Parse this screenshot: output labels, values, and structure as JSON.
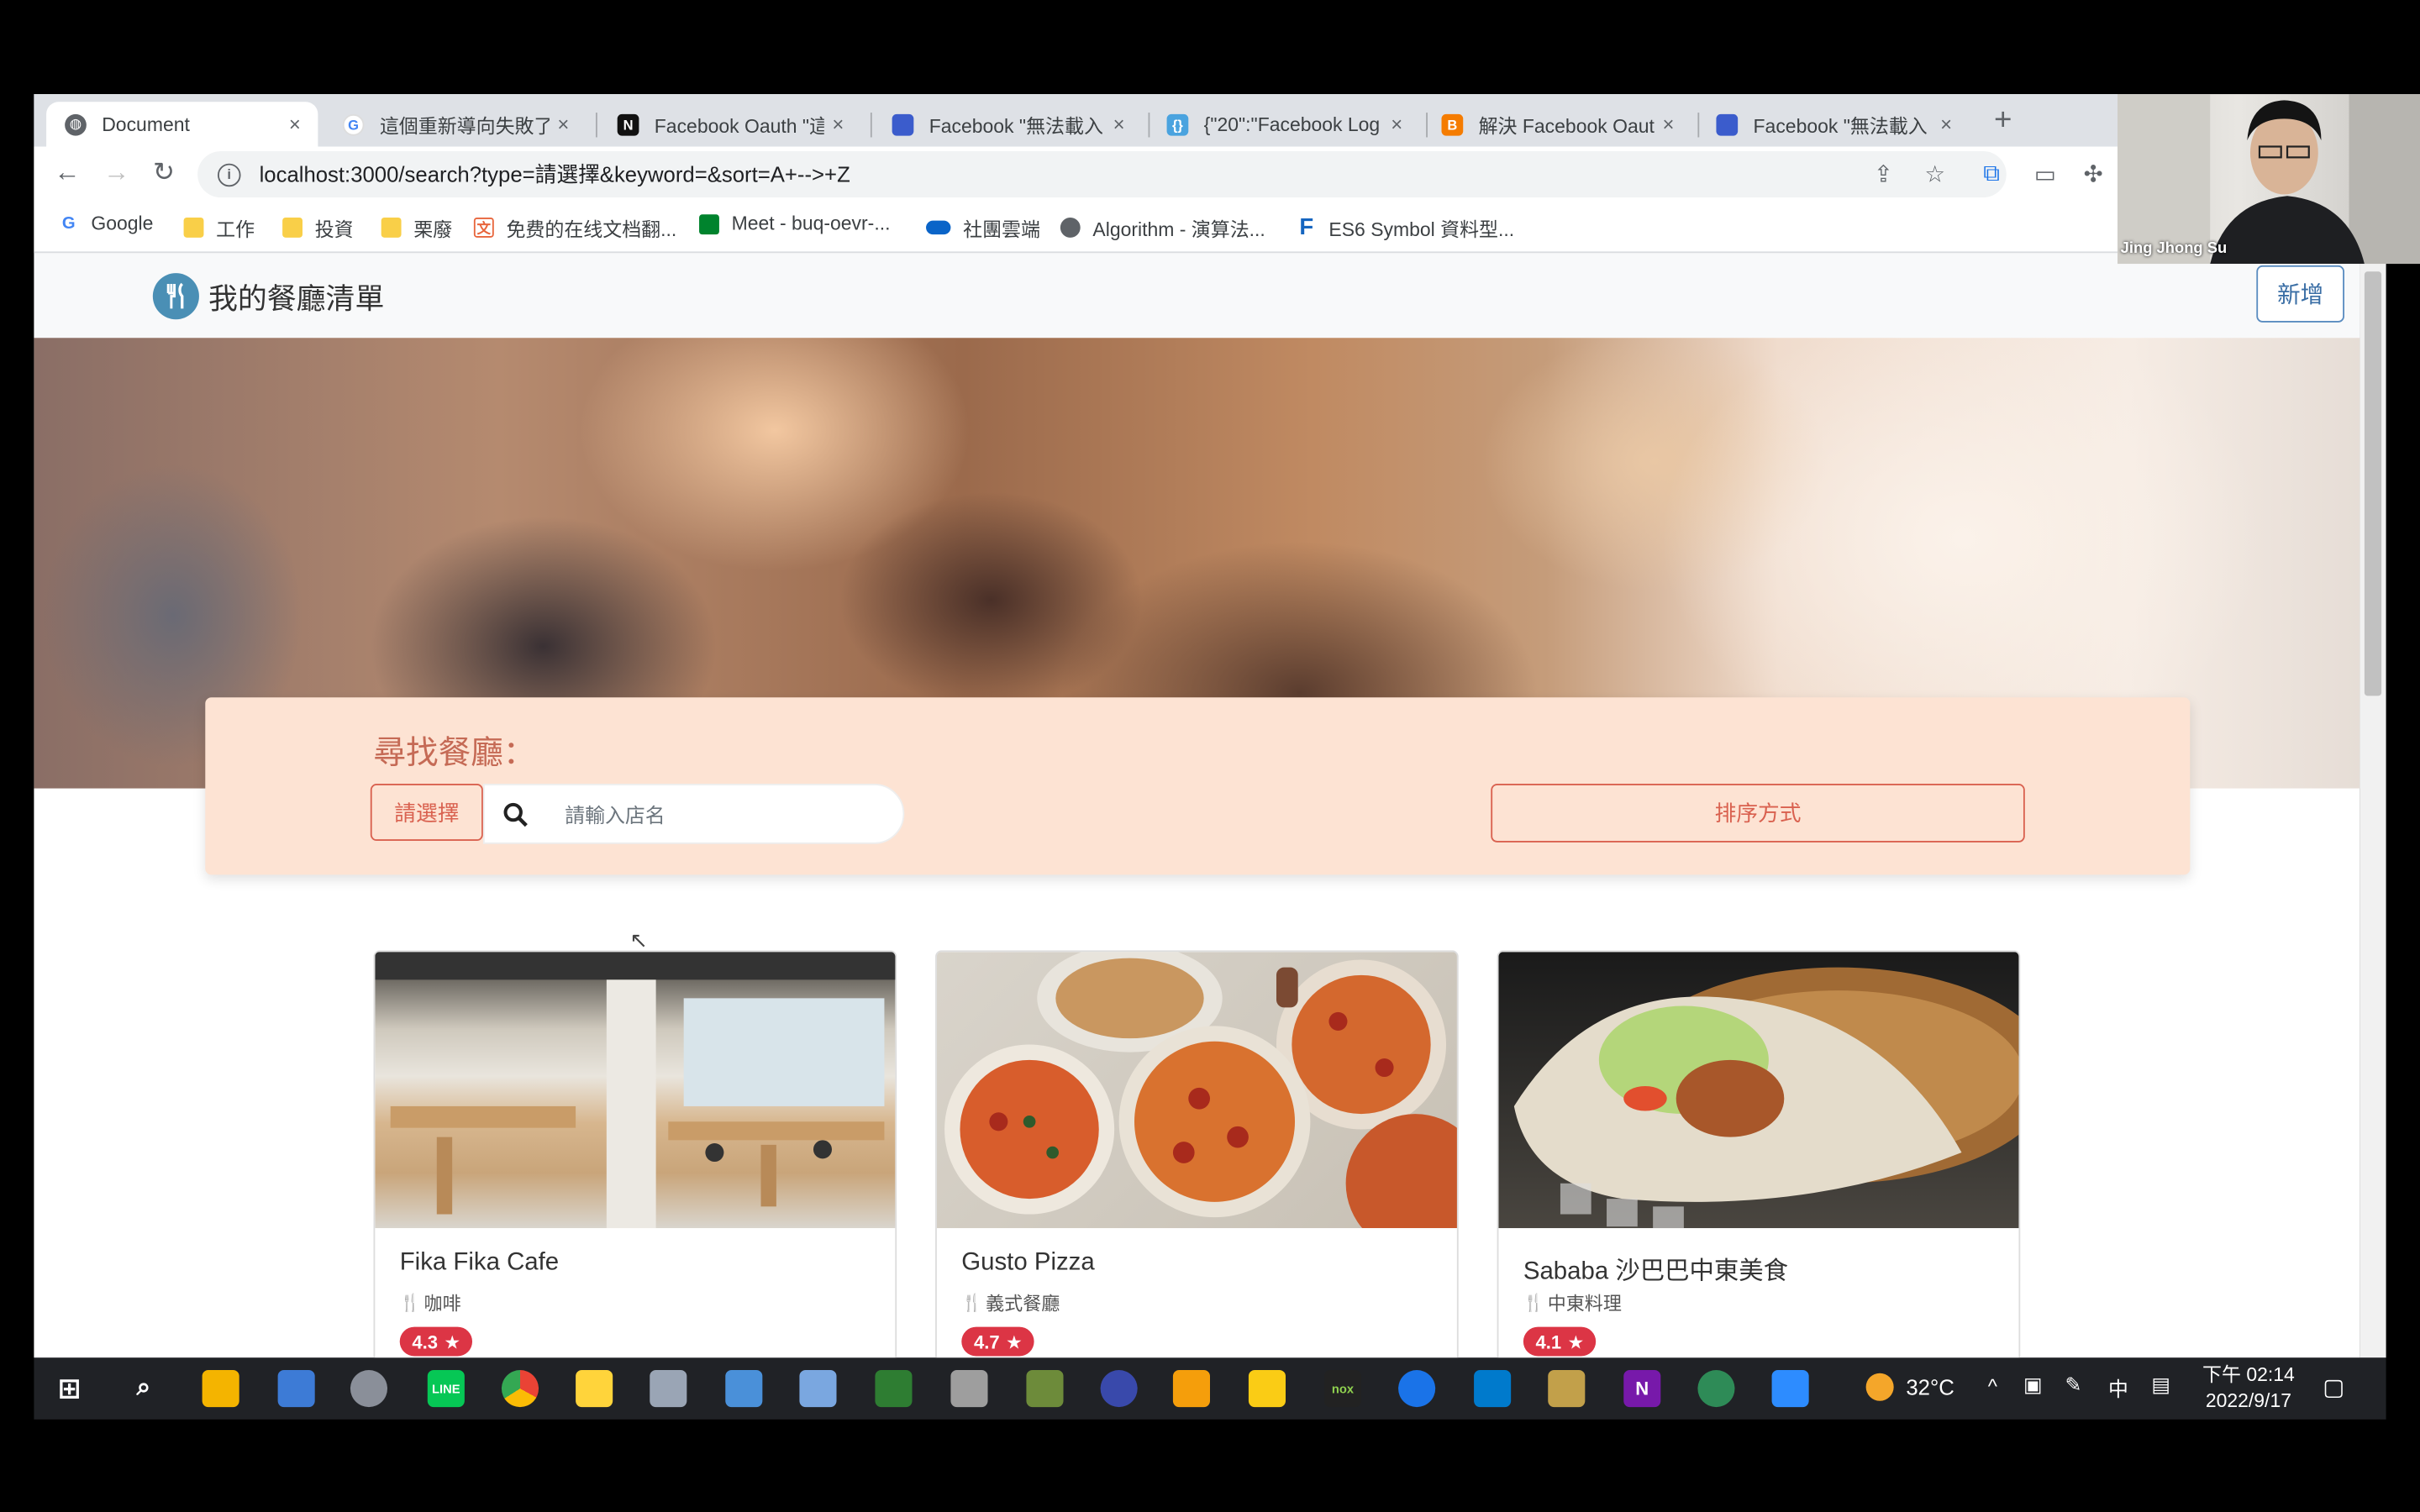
{
  "browser": {
    "tabs": [
      {
        "title": "Document",
        "active": true,
        "icon": "globe-icon"
      },
      {
        "title": "這個重新導向失敗了",
        "icon": "google-icon"
      },
      {
        "title": "Facebook Oauth \"這",
        "icon": "notion-icon"
      },
      {
        "title": "Facebook \"無法載入",
        "icon": "chat-icon"
      },
      {
        "title": "{\"20\":\"Facebook Log",
        "icon": "json-icon"
      },
      {
        "title": "解決 Facebook Oaut",
        "icon": "blogger-icon"
      },
      {
        "title": "Facebook \"無法載入",
        "icon": "chat-icon"
      }
    ],
    "new_tab": "+",
    "close": "×",
    "url": "localhost:3000/search?type=請選擇&keyword=&sort=A+-->+Z",
    "bookmarks": [
      {
        "label": "Google",
        "icon": "google-icon"
      },
      {
        "label": "工作",
        "icon": "folder-icon"
      },
      {
        "label": "投資",
        "icon": "folder-icon"
      },
      {
        "label": "栗廢",
        "icon": "folder-icon"
      },
      {
        "label": "免费的在线文档翻...",
        "icon": "translate-icon"
      },
      {
        "label": "Meet - buq-oevr-...",
        "icon": "meet-icon"
      },
      {
        "label": "社團雲端",
        "icon": "onedrive-icon"
      },
      {
        "label": "Algorithm - 演算法...",
        "icon": "globe-icon"
      },
      {
        "label": "ES6 Symbol 資料型...",
        "icon": "f-icon"
      }
    ]
  },
  "app": {
    "brand": "我的餐廳清單",
    "add_button": "新增",
    "search": {
      "title": "尋找餐廳：",
      "select_label": "請選擇",
      "placeholder": "請輸入店名",
      "sort_label": "排序方式"
    },
    "restaurants": [
      {
        "name": "Fika Fika Cafe",
        "category": "咖啡",
        "rating": "4.3"
      },
      {
        "name": "Gusto Pizza",
        "category": "義式餐廳",
        "rating": "4.7"
      },
      {
        "name": "Sababa 沙巴巴中東美食",
        "category": "中東料理",
        "rating": "4.1"
      }
    ]
  },
  "taskbar": {
    "temperature": "32°C",
    "ime": "中",
    "time": "下午 02:14",
    "date": "2022/9/17"
  },
  "video": {
    "participant": "Jing Jhong Su"
  },
  "colors": {
    "accent": "#d9614f",
    "search_bg": "#fde3d3",
    "rating_badge": "#dc3545",
    "brand_icon": "#4a8fb5"
  }
}
